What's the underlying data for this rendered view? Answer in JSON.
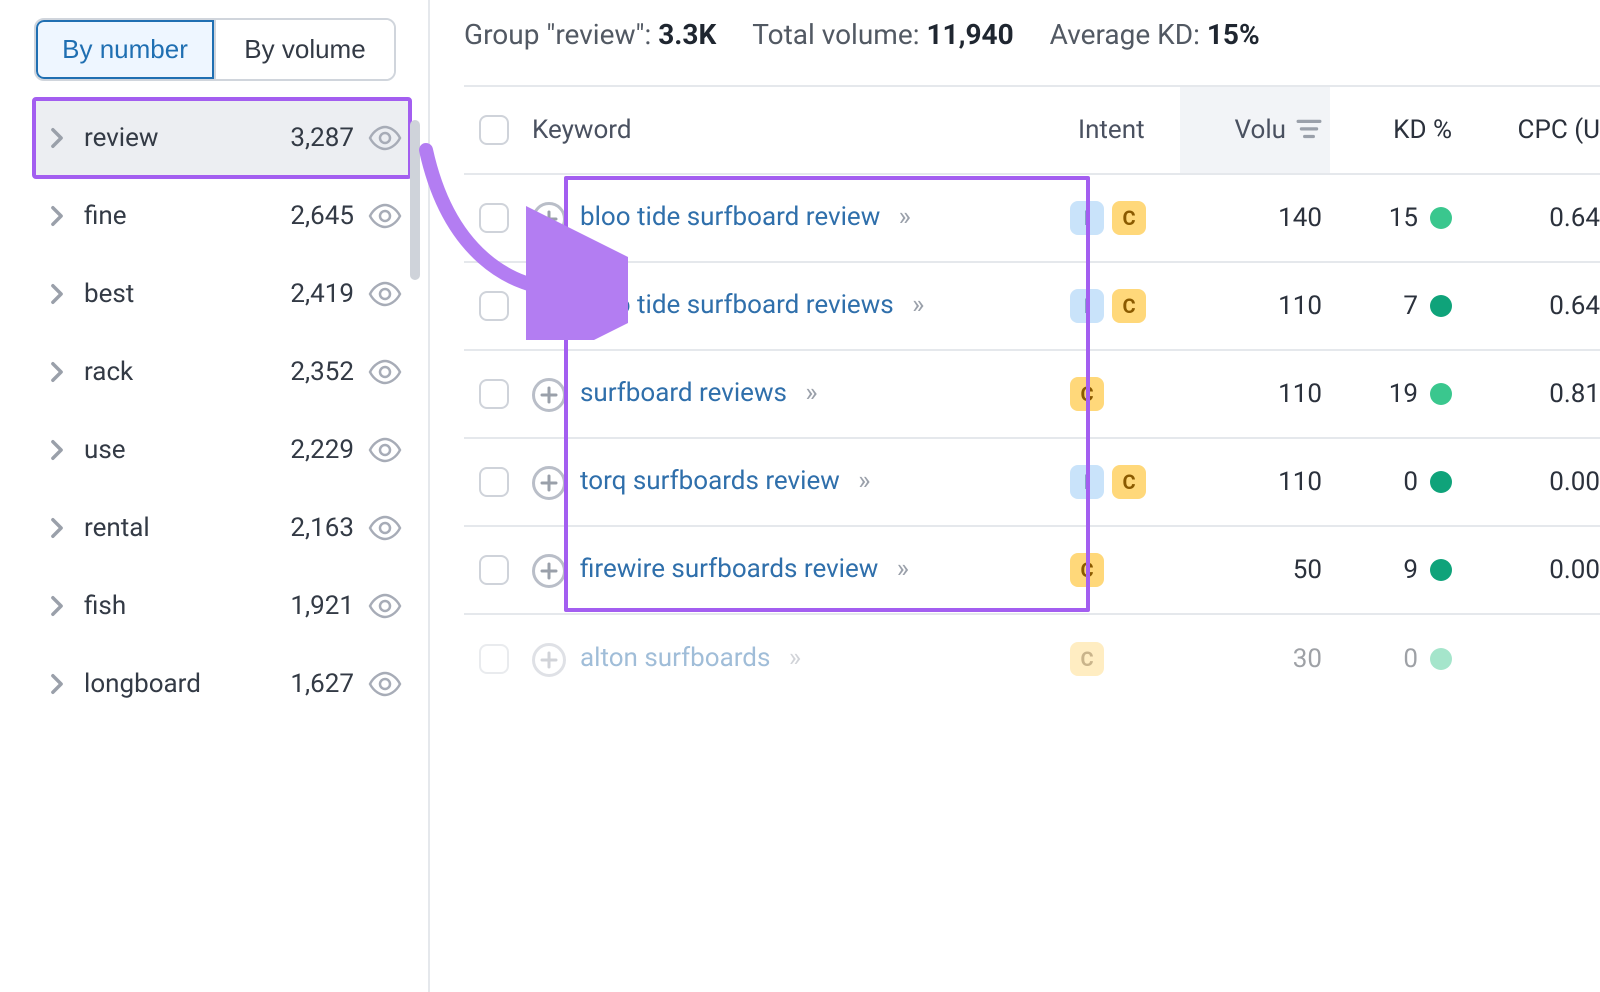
{
  "sidebar": {
    "tabs": {
      "by_number": "By number",
      "by_volume": "By volume",
      "active": "by_number"
    },
    "groups": [
      {
        "name": "review",
        "count": "3,287",
        "selected": true
      },
      {
        "name": "fine",
        "count": "2,645"
      },
      {
        "name": "best",
        "count": "2,419"
      },
      {
        "name": "rack",
        "count": "2,352"
      },
      {
        "name": "use",
        "count": "2,229"
      },
      {
        "name": "rental",
        "count": "2,163"
      },
      {
        "name": "fish",
        "count": "1,921"
      },
      {
        "name": "longboard",
        "count": "1,627"
      }
    ]
  },
  "summary": {
    "group_label": "Group \"review\":",
    "group_value": "3.3K",
    "volume_label": "Total volume:",
    "volume_value": "11,940",
    "kd_label": "Average KD:",
    "kd_value": "15%"
  },
  "columns": {
    "keyword": "Keyword",
    "intent": "Intent",
    "volume": "Volu",
    "kd": "KD %",
    "cpc": "CPC (U"
  },
  "rows": [
    {
      "keyword": "bloo tide surfboard review",
      "intent": [
        "I",
        "C"
      ],
      "volume": "140",
      "kd": "15",
      "kd_dot": "greenish",
      "cpc": "0.64"
    },
    {
      "keyword": "bloo tide surfboard reviews",
      "intent": [
        "I",
        "C"
      ],
      "volume": "110",
      "kd": "7",
      "kd_dot": "teal",
      "cpc": "0.64"
    },
    {
      "keyword": "surfboard reviews",
      "intent": [
        "C"
      ],
      "volume": "110",
      "kd": "19",
      "kd_dot": "greenish",
      "cpc": "0.81"
    },
    {
      "keyword": "torq surfboards review",
      "intent": [
        "I",
        "C"
      ],
      "volume": "110",
      "kd": "0",
      "kd_dot": "teal",
      "cpc": "0.00"
    },
    {
      "keyword": "firewire surfboards review",
      "intent": [
        "C"
      ],
      "volume": "50",
      "kd": "9",
      "kd_dot": "teal",
      "cpc": "0.00"
    },
    {
      "keyword": "alton surfboards",
      "intent": [
        "C"
      ],
      "volume": "30",
      "kd": "0",
      "kd_dot": "greenish",
      "cpc": "",
      "faded": true
    }
  ]
}
